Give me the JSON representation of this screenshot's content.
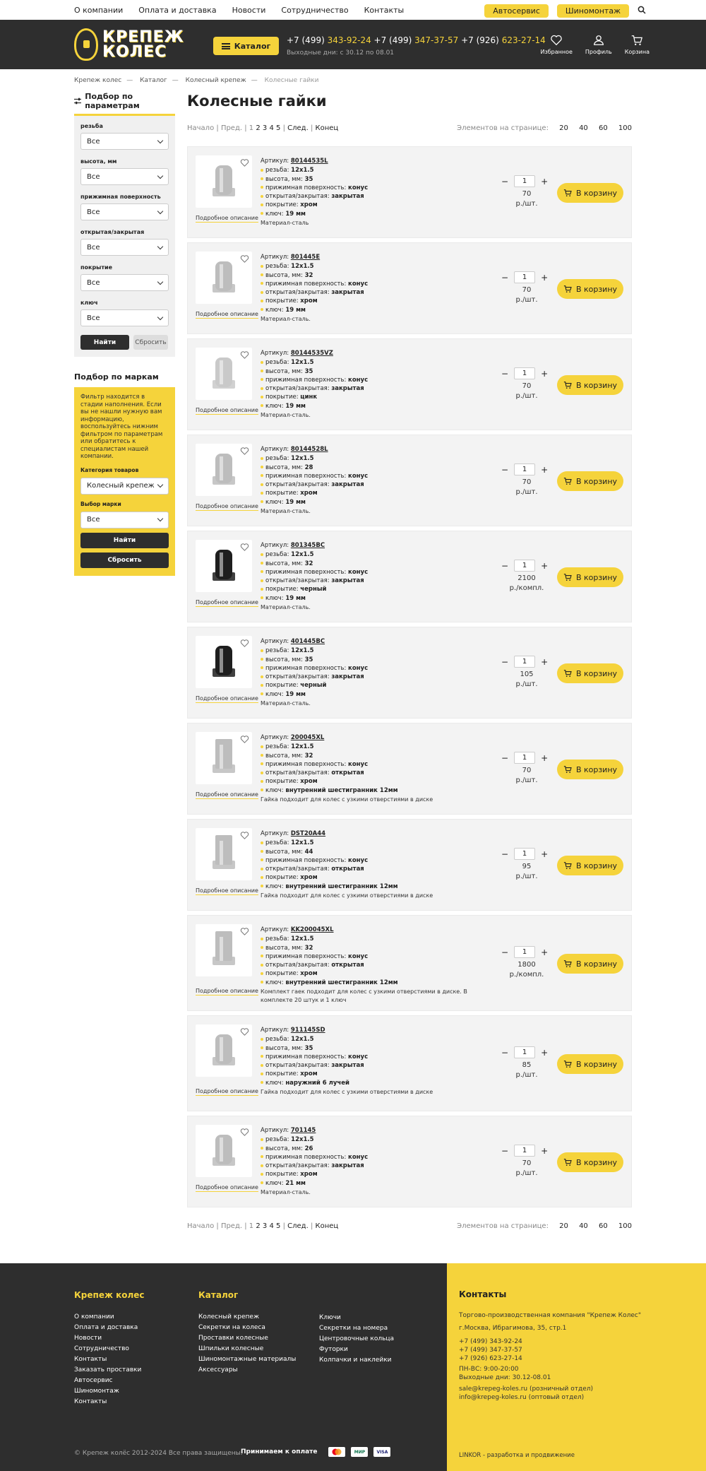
{
  "topnav": {
    "links": [
      "О компании",
      "Оплата и доставка",
      "Новости",
      "Сотрудничество",
      "Контакты"
    ],
    "autoservice": "Автосервис",
    "tire": "Шиномонтаж"
  },
  "header": {
    "logo_line1": "КРЕПЕЖ",
    "logo_line2": "КОЛЕС",
    "catalog": "Каталог",
    "phones": [
      {
        "code": "+7 (499)",
        "num": "343-92-24"
      },
      {
        "code": "+7 (499)",
        "num": "347-37-57"
      },
      {
        "code": "+7 (926)",
        "num": "623-27-14"
      }
    ],
    "hours": "Выходные дни: с 30.12 по 08.01",
    "icons": [
      {
        "name": "heart-icon",
        "label": "Избранное"
      },
      {
        "name": "user-icon",
        "label": "Профиль"
      },
      {
        "name": "cart-icon",
        "label": "Корзина"
      }
    ]
  },
  "breadcrumbs": [
    "Крепеж колес",
    "Каталог",
    "Колесный крепеж",
    "Колесные гайки"
  ],
  "sidebar": {
    "title": "Подбор по параметрам",
    "filters": [
      {
        "label": "резьба",
        "value": "Все"
      },
      {
        "label": "высота, мм",
        "value": "Все"
      },
      {
        "label": "прижимная поверхность",
        "value": "Все"
      },
      {
        "label": "открытая/закрытая",
        "value": "Все"
      },
      {
        "label": "покрытие",
        "value": "Все"
      },
      {
        "label": "ключ",
        "value": "Все"
      }
    ],
    "find": "Найти",
    "reset": "Сбросить",
    "brand_title": "Подбор по маркам",
    "brand_note": "Фильтр находится в стадии наполнения. Если вы не нашли нужную вам информацию, воспользуйтесь нижним фильтром по параметрам или обратитесь к специалистам нашей компании.",
    "cat_label": "Категория товаров",
    "cat_value": "Колесный крепеж",
    "brand_label": "Выбор марки",
    "brand_value": "Все",
    "brand_find": "Найти",
    "brand_reset": "Сбросить"
  },
  "page": {
    "title": "Колесные гайки",
    "pager": {
      "start": "Начало",
      "prev": "Пред.",
      "pages": [
        "1",
        "2",
        "3",
        "4",
        "5"
      ],
      "next": "След.",
      "end": "Конец",
      "per_page_label": "Элементов на странице:",
      "per_page": [
        "20",
        "40",
        "60",
        "100"
      ]
    },
    "desc_link": "Подробное описание",
    "art_label": "Артикул:",
    "cart_label": "В корзину",
    "qty": "1"
  },
  "products": [
    {
      "art": "80144535L",
      "attrs": [
        [
          "резьба:",
          "12x1.5"
        ],
        [
          "высота, мм:",
          "35"
        ],
        [
          "прижимная поверхность:",
          "конус"
        ],
        [
          "открытая/закрытая:",
          "закрытая"
        ],
        [
          "покрытие:",
          "хром"
        ],
        [
          "ключ:",
          "19 мм"
        ]
      ],
      "note": "Материал-сталь",
      "price": "70",
      "unit": "р./шт."
    },
    {
      "art": "801445E",
      "attrs": [
        [
          "резьба:",
          "12x1.5"
        ],
        [
          "высота, мм:",
          "32"
        ],
        [
          "прижимная поверхность:",
          "конус"
        ],
        [
          "открытая/закрытая:",
          "закрытая"
        ],
        [
          "покрытие:",
          "хром"
        ],
        [
          "ключ:",
          "19 мм"
        ]
      ],
      "note": "Материал-сталь.",
      "price": "70",
      "unit": "р./шт."
    },
    {
      "art": "80144535VZ",
      "attrs": [
        [
          "резьба:",
          "12x1.5"
        ],
        [
          "высота, мм:",
          "35"
        ],
        [
          "прижимная поверхность:",
          "конус"
        ],
        [
          "открытая/закрытая:",
          "закрытая"
        ],
        [
          "покрытие:",
          "цинк"
        ],
        [
          "ключ:",
          "19 мм"
        ]
      ],
      "note": "Материал-сталь.",
      "price": "70",
      "unit": "р./шт."
    },
    {
      "art": "80144528L",
      "attrs": [
        [
          "резьба:",
          "12x1.5"
        ],
        [
          "высота, мм:",
          "28"
        ],
        [
          "прижимная поверхность:",
          "конус"
        ],
        [
          "открытая/закрытая:",
          "закрытая"
        ],
        [
          "покрытие:",
          "хром"
        ],
        [
          "ключ:",
          "19 мм"
        ]
      ],
      "note": "Материал-сталь.",
      "price": "70",
      "unit": "р./шт."
    },
    {
      "art": "801345BC",
      "attrs": [
        [
          "резьба:",
          "12x1.5"
        ],
        [
          "высота, мм:",
          "32"
        ],
        [
          "прижимная поверхность:",
          "конус"
        ],
        [
          "открытая/закрытая:",
          "закрытая"
        ],
        [
          "покрытие:",
          "черный"
        ],
        [
          "ключ:",
          "19 мм"
        ]
      ],
      "note": "Материал-сталь.",
      "price": "2100",
      "unit": "р./компл."
    },
    {
      "art": "401445BC",
      "attrs": [
        [
          "резьба:",
          "12x1.5"
        ],
        [
          "высота, мм:",
          "35"
        ],
        [
          "прижимная поверхность:",
          "конус"
        ],
        [
          "открытая/закрытая:",
          "закрытая"
        ],
        [
          "покрытие:",
          "черный"
        ],
        [
          "ключ:",
          "19 мм"
        ]
      ],
      "note": "Материал-сталь.",
      "price": "105",
      "unit": "р./шт."
    },
    {
      "art": "200045XL",
      "attrs": [
        [
          "резьба:",
          "12x1.5"
        ],
        [
          "высота, мм:",
          "32"
        ],
        [
          "прижимная поверхность:",
          "конус"
        ],
        [
          "открытая/закрытая:",
          "открытая"
        ],
        [
          "покрытие:",
          "хром"
        ],
        [
          "ключ:",
          "внутренний шестигранник 12мм"
        ]
      ],
      "note": "Гайка подходит для колес с узкими отверстиями в диске",
      "price": "70",
      "unit": "р./шт."
    },
    {
      "art": "DST20A44",
      "attrs": [
        [
          "резьба:",
          "12x1.5"
        ],
        [
          "высота, мм:",
          "44"
        ],
        [
          "прижимная поверхность:",
          "конус"
        ],
        [
          "открытая/закрытая:",
          "открытая"
        ],
        [
          "покрытие:",
          "хром"
        ],
        [
          "ключ:",
          "внутренний шестигранник 12мм"
        ]
      ],
      "note": "Гайка подходит для колес с узкими отверстиями в диске",
      "price": "95",
      "unit": "р./шт."
    },
    {
      "art": "KK200045XL",
      "attrs": [
        [
          "резьба:",
          "12x1.5"
        ],
        [
          "высота, мм:",
          "32"
        ],
        [
          "прижимная поверхность:",
          "конус"
        ],
        [
          "открытая/закрытая:",
          "открытая"
        ],
        [
          "покрытие:",
          "хром"
        ],
        [
          "ключ:",
          "внутренний шестигранник 12мм"
        ]
      ],
      "note": "Комплект гаек подходит для колес с узкими отверстиями в диске. В комплекте 20 штук и 1 ключ",
      "price": "1800",
      "unit": "р./компл."
    },
    {
      "art": "911145SD",
      "attrs": [
        [
          "резьба:",
          "12x1.5"
        ],
        [
          "высота, мм:",
          "35"
        ],
        [
          "прижимная поверхность:",
          "конус"
        ],
        [
          "открытая/закрытая:",
          "закрытая"
        ],
        [
          "покрытие:",
          "хром"
        ],
        [
          "ключ:",
          "наружний 6 лучей"
        ]
      ],
      "note": "Гайка подходит для колес с узкими отверстиями в диске",
      "price": "85",
      "unit": "р./шт."
    },
    {
      "art": "701145",
      "attrs": [
        [
          "резьба:",
          "12x1.5"
        ],
        [
          "высота, мм:",
          "26"
        ],
        [
          "прижимная поверхность:",
          "конус"
        ],
        [
          "открытая/закрытая:",
          "закрытая"
        ],
        [
          "покрытие:",
          "хром"
        ],
        [
          "ключ:",
          "21 мм"
        ]
      ],
      "note": "Материал-сталь.",
      "price": "70",
      "unit": "р./шт."
    }
  ],
  "footer": {
    "col1_title": "Крепеж колес",
    "col1": [
      "О компании",
      "Оплата и доставка",
      "Новости",
      "Сотрудничество",
      "Контакты",
      "Заказать проставки",
      "Автосервис",
      "Шиномонтаж",
      "Контакты"
    ],
    "col2_title": "Каталог",
    "col2": [
      "Колесный крепеж",
      "Секретки на колеса",
      "Проставки колесные",
      "Шпильки колесные",
      "Шиномонтажные материалы",
      "Аксессуары"
    ],
    "col3": [
      "Ключи",
      "Секретки на номера",
      "Центровочные кольца",
      "Футорки",
      "Колпачки и наклейки"
    ],
    "contacts_title": "Контакты",
    "company": "Торгово-производственная компания \"Крепеж Колес\"",
    "address": "г.Москва, Ибрагимова, 35, стр.1",
    "phones": [
      "+7 (499) 343-92-24",
      "+7 (499) 347-37-57",
      "+7 (926) 623-27-14"
    ],
    "hours": [
      "ПН-ВС: 9:00-20:00",
      "Выходные дни: 30.12-08.01"
    ],
    "emails": [
      "sale@krepeg-koles.ru (розничный отдел)",
      "info@krepeg-koles.ru (оптовый отдел)"
    ],
    "copyright": "© Крепеж колёс 2012-2024 Все права защищены.",
    "pay_label": "Принимаем к оплате",
    "pay_cards": [
      "MC",
      "МИР",
      "VISA"
    ],
    "dev": "LINKOR - разработка и продвижение"
  }
}
